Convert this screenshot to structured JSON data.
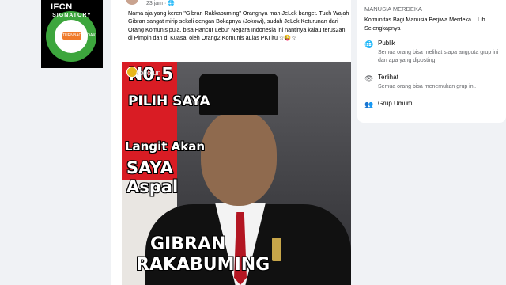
{
  "badge": {
    "logo": "IFCN",
    "logo_sub": "SIGNATORY",
    "member": "TURNBACKHOAX"
  },
  "post": {
    "time": "23 jam",
    "text": "Nama aja yang keren \"Gibran Rakkabuming\" Orangnya mah JeLek banget. Tuch Wajah Gibran sangat mirip sekali dengan Bokapnya (Jokowi), sudah JeLek Keturunan dari Orang Komunis pula, bisa Hancur Lebur Negara Indonesia ini nantinya kalau terus2an di Pimpin dan di Kuasai oleh Orang2 Komunis aLias PKI itu ☆😜☆",
    "image_text": {
      "number": "N0.5",
      "watermark": "cocotun",
      "line1": "PILIH SAYA",
      "line2": "Langit Akan",
      "line3": "SAYA",
      "line4": "Aspal",
      "name1": "GIBRAN",
      "name2": "RAKABUMING"
    }
  },
  "sidebar": {
    "group_name": "MANUSIA MERDEKA",
    "description": "Komunitas Bagi Manusia Berjiwa Merdeka... Lih",
    "more": "Selengkapnya",
    "items": [
      {
        "icon": "globe-icon",
        "heading": "Publik",
        "detail": "Semua orang bisa melihat siapa anggota grup ini dan apa yang diposting"
      },
      {
        "icon": "eye-icon",
        "heading": "Terlihat",
        "detail": "Semua orang bisa menemukan grup ini."
      },
      {
        "icon": "group-icon",
        "heading": "Grup Umum",
        "detail": ""
      }
    ]
  }
}
